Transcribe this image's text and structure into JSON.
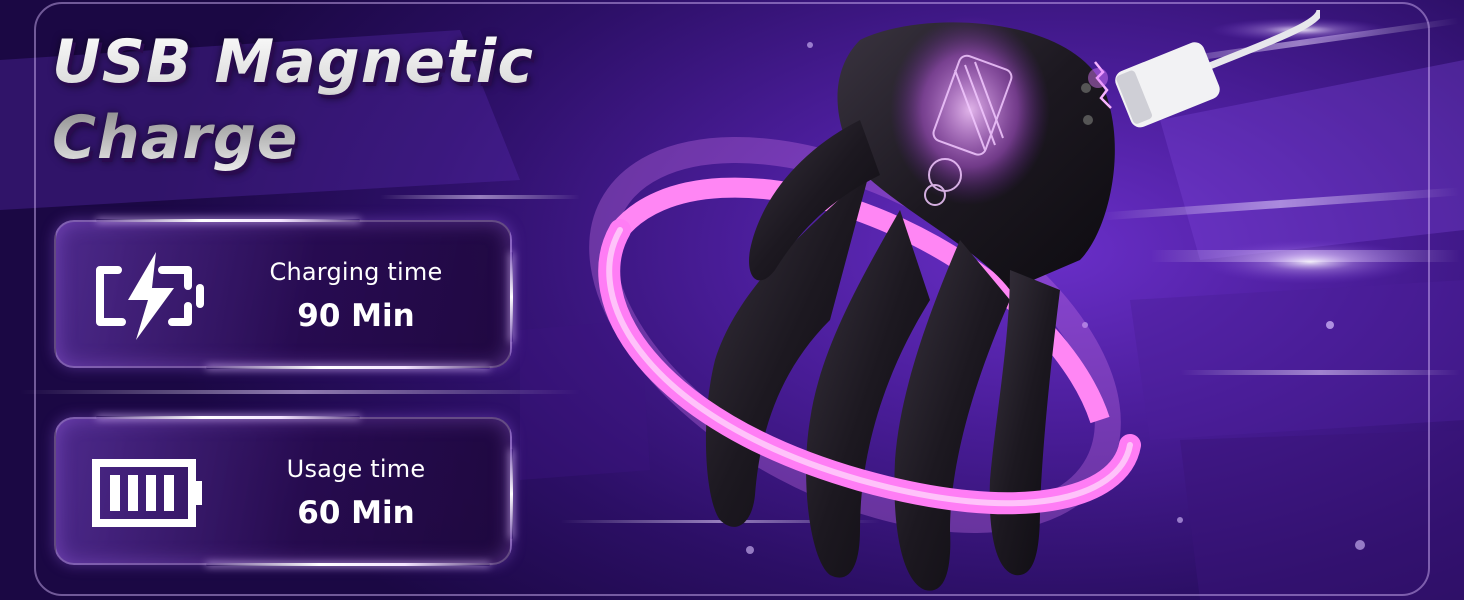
{
  "title": {
    "line1": "USB Magnetic",
    "line2": "Charge"
  },
  "stats": [
    {
      "icon": "charging-battery-icon",
      "label": "Charging time",
      "value": "90 Min"
    },
    {
      "icon": "full-battery-icon",
      "label": "Usage time",
      "value": "60 Min"
    }
  ],
  "colors": {
    "background": "#4a1d99",
    "ring": "#ff7df5",
    "card_border": "#e6c8ff",
    "text": "#ffffff"
  }
}
